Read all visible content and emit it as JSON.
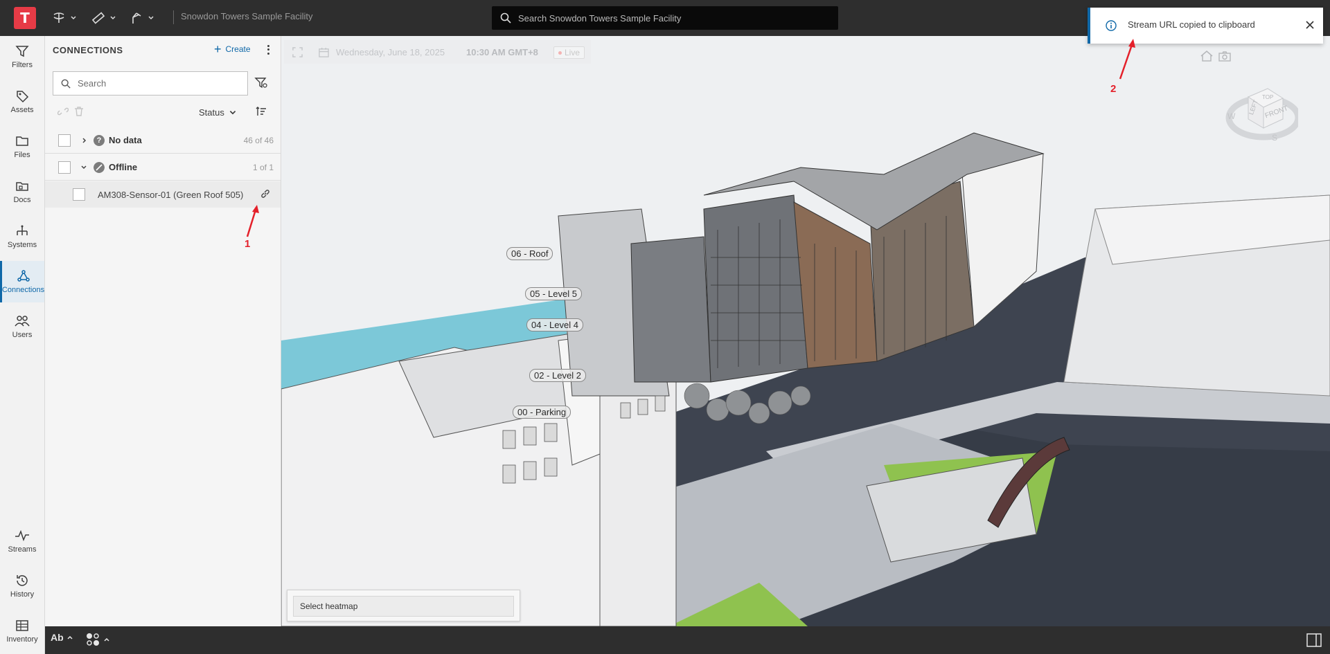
{
  "app": {
    "logo_letter": "T",
    "facility_title": "Snowdon Towers Sample Facility",
    "brand_color": "#e63b46",
    "accent_color": "#0f68a8"
  },
  "top_search": {
    "placeholder": "Search Snowdon Towers Sample Facility"
  },
  "toolbar": {
    "tools": [
      "orbit-icon",
      "measure-icon",
      "section-icon"
    ]
  },
  "rail": {
    "items": [
      {
        "label": "Filters",
        "icon": "filter-icon"
      },
      {
        "label": "Assets",
        "icon": "tag-icon"
      },
      {
        "label": "Files",
        "icon": "folder-icon"
      },
      {
        "label": "Docs",
        "icon": "docs-icon"
      },
      {
        "label": "Systems",
        "icon": "systems-icon"
      },
      {
        "label": "Connections",
        "icon": "connections-icon",
        "active": true
      },
      {
        "label": "Users",
        "icon": "users-icon"
      }
    ],
    "bottom_items": [
      {
        "label": "Streams",
        "icon": "streams-icon"
      },
      {
        "label": "History",
        "icon": "history-icon"
      },
      {
        "label": "Inventory",
        "icon": "inventory-icon"
      }
    ]
  },
  "panel": {
    "title": "CONNECTIONS",
    "create_label": "Create",
    "search_placeholder": "Search",
    "status_label": "Status",
    "groups": [
      {
        "label": "No data",
        "count": "46 of 46",
        "expanded": false,
        "status_icon": "question-icon"
      },
      {
        "label": "Offline",
        "count": "1 of 1",
        "expanded": true,
        "status_icon": "offline-icon"
      }
    ],
    "items": [
      {
        "label": "AM308-Sensor-01 (Green Roof 505)"
      }
    ]
  },
  "viewer": {
    "date": "Wednesday, June 18, 2025",
    "time": "10:30 AM GMT+8",
    "live_label": "Live",
    "level_labels": [
      "06 - Roof",
      "05 - Level 5",
      "04 - Level 4",
      "02 - Level 2",
      "00 - Parking"
    ],
    "heatmap_label": "Select heatmap",
    "viewcube": {
      "top": "TOP",
      "left": "LEFT",
      "front": "FRONT",
      "compass_w": "W",
      "compass_s": "S"
    }
  },
  "toast": {
    "message": "Stream URL copied to clipboard"
  },
  "annotations": {
    "one": "1",
    "two": "2"
  },
  "bottom_bar": {
    "text_tool_label": "Ab"
  }
}
